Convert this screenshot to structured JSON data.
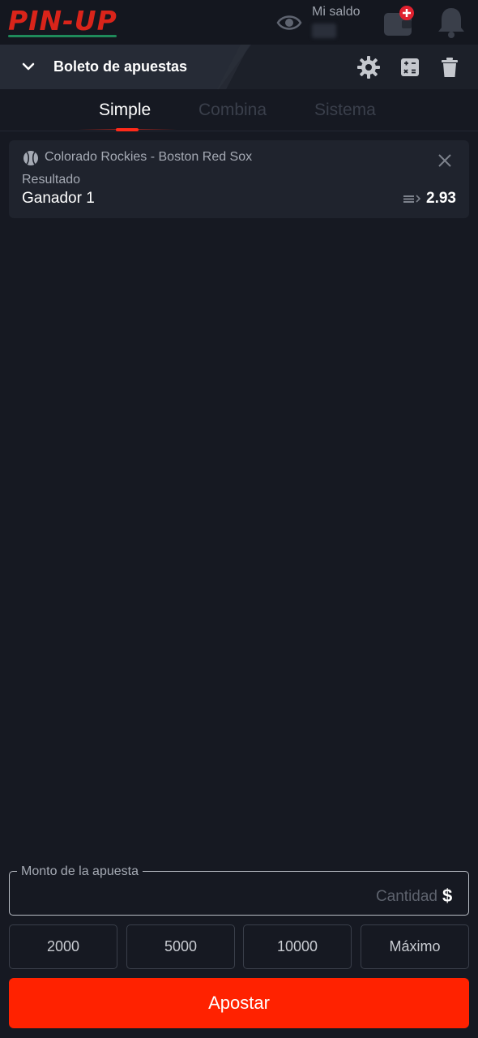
{
  "app": {
    "logo_text": "PIN-UP",
    "colors": {
      "accent": "#ff2200",
      "background": "#161922",
      "card": "#1f232d",
      "logo_red": "#d9241a",
      "logo_green": "#1f8a5a"
    }
  },
  "header": {
    "balance_label": "Mi saldo",
    "icons": [
      "eye-icon",
      "wallet-add-icon",
      "bell-icon"
    ]
  },
  "slip": {
    "title": "Boleto de apuestas",
    "icons": [
      "chevron-down-icon",
      "gear-icon",
      "calculator-icon",
      "trash-icon"
    ],
    "tabs": [
      {
        "label": "Simple",
        "active": true
      },
      {
        "label": "Combina",
        "active": false
      },
      {
        "label": "Sistema",
        "active": false
      }
    ]
  },
  "bet": {
    "sport_icon": "baseball-icon",
    "match": "Colorado Rockies - Boston Red Sox",
    "market": "Resultado",
    "selection": "Ganador 1",
    "odds": "2.93"
  },
  "stake": {
    "label": "Monto de la apuesta",
    "placeholder": "Cantidad",
    "value": "",
    "currency": "$",
    "quick_amounts": [
      "2000",
      "5000",
      "10000",
      "Máximo"
    ]
  },
  "actions": {
    "place_bet": "Apostar"
  }
}
